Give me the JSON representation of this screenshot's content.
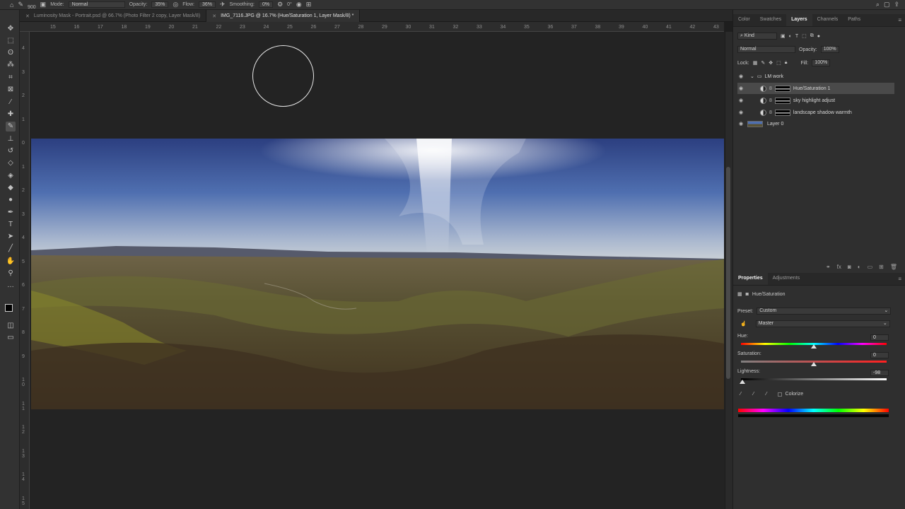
{
  "options": {
    "brush_size": "900",
    "mode_label": "Mode:",
    "mode_value": "Normal",
    "opacity_label": "Opacity:",
    "opacity_value": "35%",
    "flow_label": "Flow:",
    "flow_value": "36%",
    "smoothing_label": "Smoothing:",
    "smoothing_value": "0%",
    "angle_value": "0°"
  },
  "tabs": [
    {
      "label": "Luminosity Mask - Portrait.psd @ 66.7% (Photo Filter 2 copy, Layer Mask/8)",
      "active": false
    },
    {
      "label": "IMG_7116.JPG @ 16.7% (Hue/Saturation 1, Layer Mask/8) *",
      "active": true
    }
  ],
  "ruler_h": [
    "15",
    "16",
    "17",
    "18",
    "19",
    "20",
    "21",
    "22",
    "23",
    "24",
    "25",
    "26",
    "27",
    "28",
    "29",
    "30",
    "31",
    "32",
    "33",
    "34",
    "35",
    "36",
    "37",
    "38",
    "39",
    "40",
    "41",
    "42",
    "43"
  ],
  "ruler_v": [
    "4",
    "3",
    "2",
    "1",
    "0",
    "1",
    "2",
    "3",
    "4",
    "5",
    "6",
    "7",
    "8",
    "9",
    "1 0",
    "1 1",
    "1 2",
    "1 3",
    "1 4",
    "1 5"
  ],
  "panel_top": {
    "tabs": [
      "Color",
      "Swatches",
      "Layers",
      "Channels",
      "Paths"
    ],
    "active_tab": "Layers",
    "kind_label": "Kind",
    "blend_mode": "Normal",
    "opacity_label": "Opacity:",
    "opacity_value": "100%",
    "lock_label": "Lock:",
    "fill_label": "Fill:",
    "fill_value": "100%",
    "layers": [
      {
        "name": "LM work",
        "type": "group"
      },
      {
        "name": "Hue/Saturation 1",
        "type": "adjustment",
        "selected": true
      },
      {
        "name": "sky highlight adjust",
        "type": "adjustment"
      },
      {
        "name": "landscape shadow warmth",
        "type": "adjustment"
      },
      {
        "name": "Layer 0",
        "type": "pixel"
      }
    ]
  },
  "properties": {
    "tabs": [
      "Properties",
      "Adjustments"
    ],
    "active_tab": "Properties",
    "header": "Hue/Saturation",
    "preset_label": "Preset:",
    "preset_value": "Custom",
    "channel_value": "Master",
    "hue_label": "Hue:",
    "hue_value": "0",
    "hue_level": 0,
    "saturation_label": "Saturation:",
    "saturation_value": "0",
    "saturation_level": 0,
    "lightness_label": "Lightness:",
    "lightness_value": "-98",
    "lightness_level": -98,
    "colorize_label": "Colorize"
  },
  "colors": {
    "accent_bg": "#323232",
    "panel_bg": "#2f2f2f",
    "canvas_bg": "#232323",
    "selected_layer": "#4a4a4a"
  }
}
